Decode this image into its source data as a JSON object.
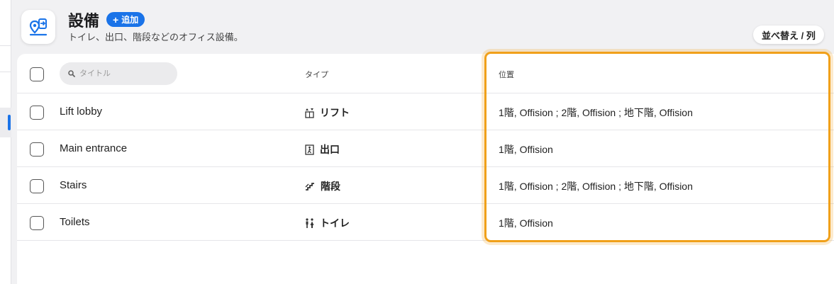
{
  "header": {
    "title": "設備",
    "add_label": "追加",
    "subtitle": "トイレ、出口、階段などのオフィス設備。",
    "sort_label": "並べ替え / 列"
  },
  "table": {
    "search_placeholder": "タイトル",
    "type_header": "タイプ",
    "location_header": "位置",
    "rows": [
      {
        "title": "Lift lobby",
        "type": "リフト",
        "type_icon": "elevator-icon",
        "location": "1階, Offision ; 2階, Offision ; 地下階, Offision"
      },
      {
        "title": "Main entrance",
        "type": "出口",
        "type_icon": "exit-icon",
        "location": "1階, Offision"
      },
      {
        "title": "Stairs",
        "type": "階段",
        "type_icon": "stairs-icon",
        "location": "1階, Offision ; 2階, Offision ; 地下階, Offision"
      },
      {
        "title": "Toilets",
        "type": "トイレ",
        "type_icon": "toilet-icon",
        "location": "1階, Offision"
      }
    ]
  },
  "colors": {
    "accent": "#1a73e8",
    "highlight": "#f0a01a"
  }
}
